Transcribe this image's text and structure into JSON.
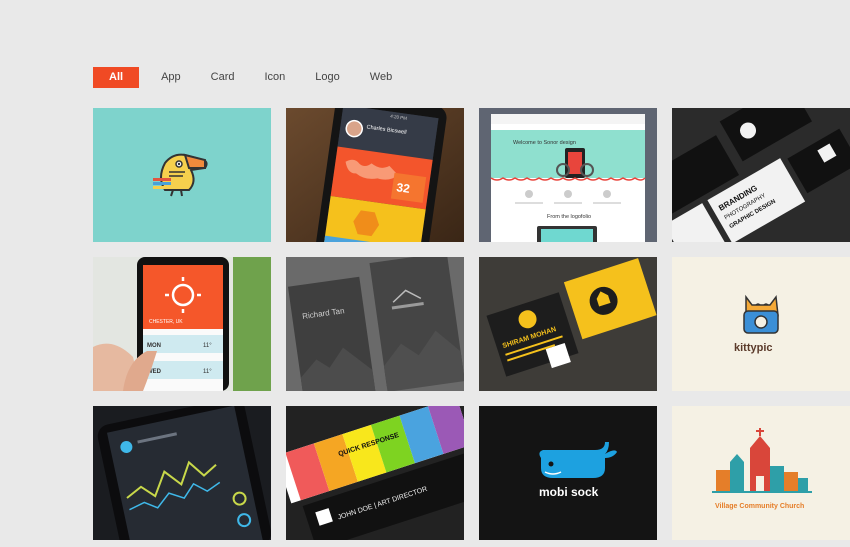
{
  "filters": [
    {
      "label": "All",
      "active": true
    },
    {
      "label": "App",
      "active": false
    },
    {
      "label": "Card",
      "active": false
    },
    {
      "label": "Icon",
      "active": false
    },
    {
      "label": "Logo",
      "active": false
    },
    {
      "label": "Web",
      "active": false
    }
  ],
  "tiles": {
    "t2_name": "Charles Bicswell",
    "t2_time": "4:20 PM",
    "t2_num": "32",
    "t3_title": "Welcome to Sonor design",
    "t3_sub": "From the logofolio",
    "t4_words": [
      "BRANDING",
      "PHOTOGRAPHY",
      "GRAPHIC DESIGN"
    ],
    "t5_loc": "CHESTER, UK",
    "t5_day1": "MON",
    "t5_day2": "WED",
    "t5_t1": "11°",
    "t5_t2": "11°",
    "t6_name": "Richard Tan",
    "t7_name": "SHIRAM MOHAN",
    "t8_text": "kittypic",
    "t10_text": "QUICK RESPONSE",
    "t10_name": "JOHN DOE | ART DIRECTOR",
    "t11_text": "mobi sock",
    "t12_text": "Village Community Church"
  },
  "colors": {
    "accent": "#f04a24",
    "teal": "#7ed3cc",
    "phone_orange": "#f5572a",
    "whale_blue": "#1da1e0",
    "cream": "#f5f1e4",
    "church_teal": "#2e9fa8",
    "church_orange": "#e57e29"
  }
}
